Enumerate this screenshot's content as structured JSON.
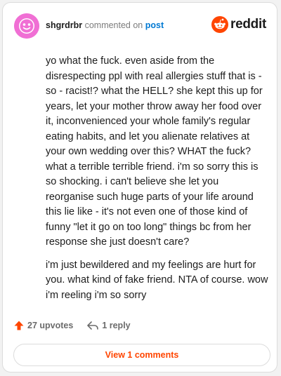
{
  "comment": {
    "username": "shgrdrbr",
    "action_text": "commented on",
    "post_link": "post",
    "paragraphs": [
      "yo what the fuck. even aside from the disrespecting ppl with real allergies stuff that is - so - racist!? what the HELL? she kept this up for years, let your mother throw away her food over it, inconvenienced your whole family's regular eating habits, and let you alienate relatives at your own wedding over this? WHAT the fuck? what a terrible terrible friend. i'm so sorry this is so shocking. i can't believe she let you reorganise such huge parts of your life around this lie like - it's not even one of those kind of funny \"let it go on too long\" things bc from her response she just doesn't care?",
      "i'm just bewildered and my feelings are hurt for you. what kind of fake friend. NTA of course. wow i'm reeling i'm so sorry"
    ]
  },
  "brand": {
    "name": "reddit",
    "accent_color": "#ff4500",
    "link_color": "#0079d3"
  },
  "actions": {
    "upvotes_label": "27 upvotes",
    "reply_label": "1 reply",
    "upvote_icon": "upvote-arrow-icon",
    "reply_icon": "reply-arrow-icon"
  },
  "footer": {
    "view_comments_label": "View 1 comments"
  }
}
